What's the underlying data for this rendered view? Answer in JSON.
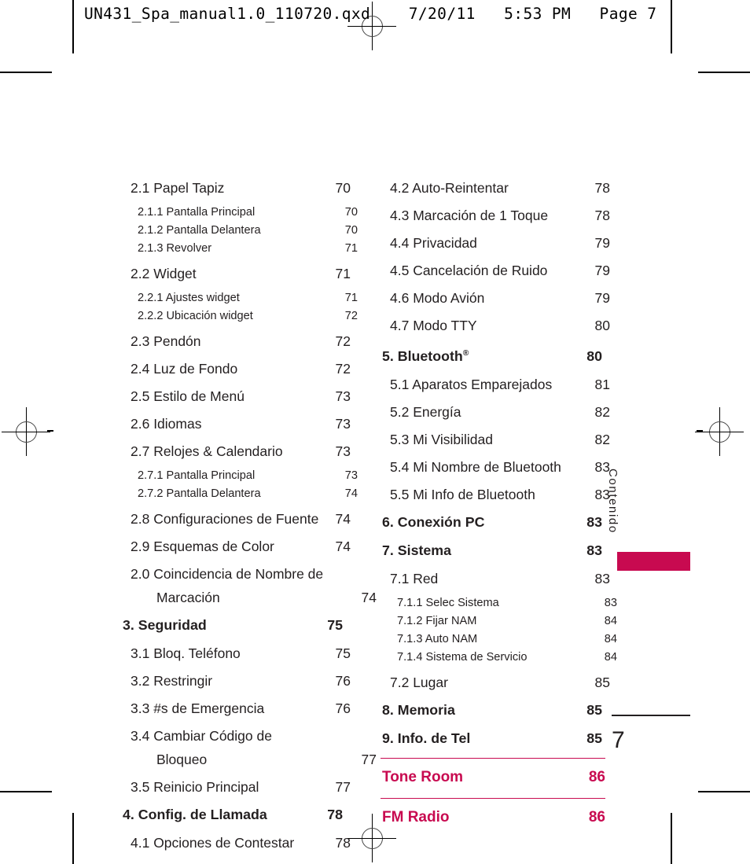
{
  "prepress": {
    "file_header": "UN431_Spa_manual1.0_110720.qxd    7/20/11   5:53 PM   Page 7",
    "registration_mark_name": "registration-target"
  },
  "side_tab": {
    "label": "Contenido",
    "color": "#c80a50"
  },
  "folio": {
    "page_number": "7"
  },
  "theme": {
    "accent": "#c80a50",
    "text": "#231f20"
  },
  "toc": {
    "left_column": [
      {
        "level": 1,
        "title": "2.1 Papel Tapiz",
        "page": "70"
      },
      {
        "level": 2,
        "title": "2.1.1 Pantalla Principal",
        "page": "70"
      },
      {
        "level": 2,
        "title": "2.1.2 Pantalla Delantera",
        "page": "70"
      },
      {
        "level": 2,
        "title": "2.1.3 Revolver",
        "page": "71"
      },
      {
        "level": 1,
        "title": "2.2 Widget",
        "page": "71"
      },
      {
        "level": 2,
        "title": "2.2.1 Ajustes widget",
        "page": "71"
      },
      {
        "level": 2,
        "title": "2.2.2 Ubicación widget",
        "page": "72"
      },
      {
        "level": 1,
        "title": "2.3 Pendón",
        "page": "72"
      },
      {
        "level": 1,
        "title": "2.4 Luz de Fondo",
        "page": "72"
      },
      {
        "level": 1,
        "title": "2.5 Estilo de Menú",
        "page": "73"
      },
      {
        "level": 1,
        "title": "2.6 Idiomas",
        "page": "73"
      },
      {
        "level": 1,
        "title": "2.7 Relojes & Calendario",
        "page": "73"
      },
      {
        "level": 2,
        "title": "2.7.1 Pantalla Principal",
        "page": "73"
      },
      {
        "level": 2,
        "title": "2.7.2 Pantalla Delantera",
        "page": "74"
      },
      {
        "level": 1,
        "title": "2.8 Configuraciones de Fuente",
        "page": "74"
      },
      {
        "level": 1,
        "title": "2.9 Esquemas de Color",
        "page": "74"
      },
      {
        "level": 1,
        "title": "2.0 Coincidencia de Nombre de",
        "page": "",
        "cont": "Marcación",
        "cont_page": "74"
      },
      {
        "level": 0,
        "title": "3. Seguridad",
        "page": "75"
      },
      {
        "level": 1,
        "title": "3.1 Bloq. Teléfono",
        "page": "75"
      },
      {
        "level": 1,
        "title": "3.2 Restringir",
        "page": "76"
      },
      {
        "level": 1,
        "title": "3.3 #s de Emergencia",
        "page": "76"
      },
      {
        "level": 1,
        "title": "3.4 Cambiar Código de",
        "page": "",
        "cont": "Bloqueo",
        "cont_page": "77"
      },
      {
        "level": 1,
        "title": "3.5 Reinicio Principal",
        "page": "77"
      },
      {
        "level": 0,
        "title": "4. Config. de Llamada",
        "page": "78"
      },
      {
        "level": 1,
        "title": "4.1 Opciones de Contestar",
        "page": "78"
      }
    ],
    "right_column": [
      {
        "level": 1,
        "title": "4.2 Auto-Reintentar",
        "page": "78"
      },
      {
        "level": 1,
        "title": "4.3 Marcación de 1 Toque",
        "page": "78"
      },
      {
        "level": 1,
        "title": "4.4 Privacidad",
        "page": "79"
      },
      {
        "level": 1,
        "title": "4.5 Cancelación de Ruido",
        "page": "79"
      },
      {
        "level": 1,
        "title": "4.6 Modo Avión",
        "page": "79"
      },
      {
        "level": 1,
        "title": "4.7 Modo TTY",
        "page": "80"
      },
      {
        "level": 0,
        "title": "5. Bluetooth",
        "sup": "®",
        "page": "80"
      },
      {
        "level": 1,
        "title": "5.1 Aparatos Emparejados",
        "page": "81"
      },
      {
        "level": 1,
        "title": "5.2 Energía",
        "page": "82"
      },
      {
        "level": 1,
        "title": "5.3 Mi Visibilidad",
        "page": "82"
      },
      {
        "level": 1,
        "title": "5.4  Mi Nombre de Bluetooth",
        "page": "83"
      },
      {
        "level": 1,
        "title": "5.5 Mi Info de Bluetooth",
        "page": "83"
      },
      {
        "level": 0,
        "title": "6. Conexión PC",
        "page": "83"
      },
      {
        "level": 0,
        "title": "7. Sistema",
        "page": "83"
      },
      {
        "level": 1,
        "title": "7.1 Red",
        "page": "83"
      },
      {
        "level": 2,
        "title": "7.1.1 Selec Sistema",
        "page": "83"
      },
      {
        "level": 2,
        "title": "7.1.2 Fijar NAM",
        "page": "84"
      },
      {
        "level": 2,
        "title": "7.1.3 Auto NAM",
        "page": "84"
      },
      {
        "level": 2,
        "title": "7.1.4 Sistema de Servicio",
        "page": "84"
      },
      {
        "level": 1,
        "title": "7.2 Lugar",
        "page": "85"
      },
      {
        "level": 0,
        "title": "8. Memoria",
        "page": "85"
      },
      {
        "level": 0,
        "title": "9. Info. de Tel",
        "page": "85"
      }
    ],
    "highlighted": [
      {
        "title": "Tone Room",
        "page": "86"
      },
      {
        "title": "FM Radio",
        "page": "86"
      }
    ]
  }
}
